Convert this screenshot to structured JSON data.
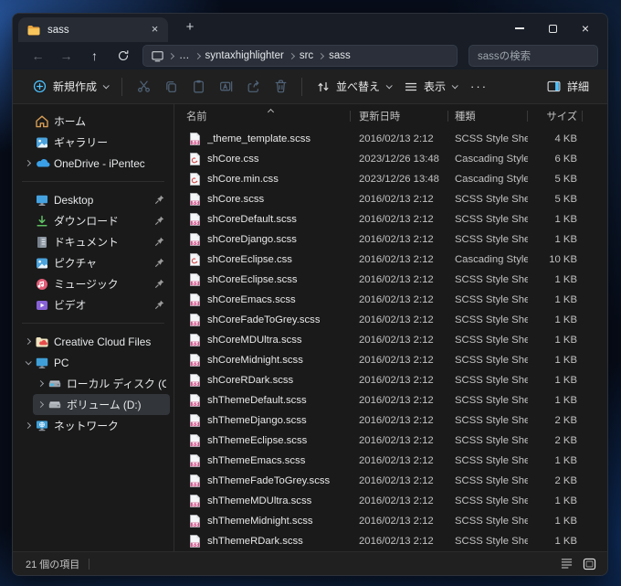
{
  "window": {
    "tab_title": "sass",
    "tab_icon": "folder-icon",
    "new_tab_label": "+",
    "controls": [
      "minimize-icon",
      "maximize-icon",
      "close-icon"
    ]
  },
  "address": {
    "device_icon": "this-pc-icon",
    "breadcrumbs": [
      "…",
      "syntaxhighlighter",
      "src",
      "sass"
    ],
    "search_text": "sassの検索"
  },
  "toolbar": {
    "new_label": "新規作成",
    "sort_label": "並べ替え",
    "view_label": "表示",
    "more_label": "···",
    "details_label": "詳細",
    "accent_color": "#4cc2ff",
    "disabled_icon_color": "#51647a"
  },
  "sidebar": {
    "items": [
      {
        "key": "home",
        "label": "ホーム",
        "icon": "home-icon",
        "chevron": "none",
        "pinned": false,
        "selected": false,
        "indent": 0
      },
      {
        "key": "gallery",
        "label": "ギャラリー",
        "icon": "gallery-icon",
        "chevron": "none",
        "pinned": false,
        "selected": false,
        "indent": 0
      },
      {
        "key": "onedrive",
        "label": "OneDrive - iPentec",
        "icon": "onedrive-icon",
        "chevron": "collapsed",
        "pinned": false,
        "selected": false,
        "indent": 0
      },
      {
        "divider": true
      },
      {
        "key": "desktop",
        "label": "Desktop",
        "icon": "desktop-icon",
        "chevron": "none",
        "pinned": true,
        "selected": false,
        "indent": 0
      },
      {
        "key": "downloads",
        "label": "ダウンロード",
        "icon": "downloads-icon",
        "chevron": "none",
        "pinned": true,
        "selected": false,
        "indent": 0
      },
      {
        "key": "documents",
        "label": "ドキュメント",
        "icon": "documents-icon",
        "chevron": "none",
        "pinned": true,
        "selected": false,
        "indent": 0
      },
      {
        "key": "pictures",
        "label": "ピクチャ",
        "icon": "pictures-icon",
        "chevron": "none",
        "pinned": true,
        "selected": false,
        "indent": 0
      },
      {
        "key": "music",
        "label": "ミュージック",
        "icon": "music-icon",
        "chevron": "none",
        "pinned": true,
        "selected": false,
        "indent": 0
      },
      {
        "key": "videos",
        "label": "ビデオ",
        "icon": "videos-icon",
        "chevron": "none",
        "pinned": true,
        "selected": false,
        "indent": 0
      },
      {
        "divider": true
      },
      {
        "key": "creative-cloud",
        "label": "Creative Cloud Files",
        "icon": "creative-cloud-icon",
        "chevron": "collapsed",
        "pinned": false,
        "selected": false,
        "indent": 0
      },
      {
        "key": "pc",
        "label": "PC",
        "icon": "pc-icon",
        "chevron": "expanded",
        "pinned": false,
        "selected": false,
        "indent": 0
      },
      {
        "key": "local-disk-c",
        "label": "ローカル ディスク (C:)",
        "icon": "system-drive-icon",
        "chevron": "collapsed",
        "pinned": false,
        "selected": false,
        "indent": 1
      },
      {
        "key": "volume-d",
        "label": "ボリューム (D:)",
        "icon": "drive-icon",
        "chevron": "collapsed",
        "pinned": false,
        "selected": true,
        "indent": 1
      },
      {
        "key": "network",
        "label": "ネットワーク",
        "icon": "network-icon",
        "chevron": "collapsed",
        "pinned": false,
        "selected": false,
        "indent": 0
      }
    ]
  },
  "files": {
    "columns": [
      "名前",
      "更新日時",
      "種類",
      "サイズ"
    ],
    "sorted_column": "名前",
    "sort_direction": "ascending",
    "rows": [
      {
        "name": "_theme_template.scss",
        "modified": "2016/02/13 2:12",
        "type": "SCSS Style Sheet",
        "size": "4 KB",
        "icon": "scss-file-icon"
      },
      {
        "name": "shCore.css",
        "modified": "2023/12/26 13:48",
        "type": "Cascading Style S...",
        "size": "6 KB",
        "icon": "css-file-icon"
      },
      {
        "name": "shCore.min.css",
        "modified": "2023/12/26 13:48",
        "type": "Cascading Style S...",
        "size": "5 KB",
        "icon": "css-file-icon"
      },
      {
        "name": "shCore.scss",
        "modified": "2016/02/13 2:12",
        "type": "SCSS Style Sheet",
        "size": "5 KB",
        "icon": "scss-file-icon"
      },
      {
        "name": "shCoreDefault.scss",
        "modified": "2016/02/13 2:12",
        "type": "SCSS Style Sheet",
        "size": "1 KB",
        "icon": "scss-file-icon"
      },
      {
        "name": "shCoreDjango.scss",
        "modified": "2016/02/13 2:12",
        "type": "SCSS Style Sheet",
        "size": "1 KB",
        "icon": "scss-file-icon"
      },
      {
        "name": "shCoreEclipse.css",
        "modified": "2016/02/13 2:12",
        "type": "Cascading Style S...",
        "size": "10 KB",
        "icon": "css-file-icon"
      },
      {
        "name": "shCoreEclipse.scss",
        "modified": "2016/02/13 2:12",
        "type": "SCSS Style Sheet",
        "size": "1 KB",
        "icon": "scss-file-icon"
      },
      {
        "name": "shCoreEmacs.scss",
        "modified": "2016/02/13 2:12",
        "type": "SCSS Style Sheet",
        "size": "1 KB",
        "icon": "scss-file-icon"
      },
      {
        "name": "shCoreFadeToGrey.scss",
        "modified": "2016/02/13 2:12",
        "type": "SCSS Style Sheet",
        "size": "1 KB",
        "icon": "scss-file-icon"
      },
      {
        "name": "shCoreMDUltra.scss",
        "modified": "2016/02/13 2:12",
        "type": "SCSS Style Sheet",
        "size": "1 KB",
        "icon": "scss-file-icon"
      },
      {
        "name": "shCoreMidnight.scss",
        "modified": "2016/02/13 2:12",
        "type": "SCSS Style Sheet",
        "size": "1 KB",
        "icon": "scss-file-icon"
      },
      {
        "name": "shCoreRDark.scss",
        "modified": "2016/02/13 2:12",
        "type": "SCSS Style Sheet",
        "size": "1 KB",
        "icon": "scss-file-icon"
      },
      {
        "name": "shThemeDefault.scss",
        "modified": "2016/02/13 2:12",
        "type": "SCSS Style Sheet",
        "size": "1 KB",
        "icon": "scss-file-icon"
      },
      {
        "name": "shThemeDjango.scss",
        "modified": "2016/02/13 2:12",
        "type": "SCSS Style Sheet",
        "size": "2 KB",
        "icon": "scss-file-icon"
      },
      {
        "name": "shThemeEclipse.scss",
        "modified": "2016/02/13 2:12",
        "type": "SCSS Style Sheet",
        "size": "2 KB",
        "icon": "scss-file-icon"
      },
      {
        "name": "shThemeEmacs.scss",
        "modified": "2016/02/13 2:12",
        "type": "SCSS Style Sheet",
        "size": "1 KB",
        "icon": "scss-file-icon"
      },
      {
        "name": "shThemeFadeToGrey.scss",
        "modified": "2016/02/13 2:12",
        "type": "SCSS Style Sheet",
        "size": "2 KB",
        "icon": "scss-file-icon"
      },
      {
        "name": "shThemeMDUltra.scss",
        "modified": "2016/02/13 2:12",
        "type": "SCSS Style Sheet",
        "size": "1 KB",
        "icon": "scss-file-icon"
      },
      {
        "name": "shThemeMidnight.scss",
        "modified": "2016/02/13 2:12",
        "type": "SCSS Style Sheet",
        "size": "1 KB",
        "icon": "scss-file-icon"
      },
      {
        "name": "shThemeRDark.scss",
        "modified": "2016/02/13 2:12",
        "type": "SCSS Style Sheet",
        "size": "1 KB",
        "icon": "scss-file-icon"
      }
    ]
  },
  "statusbar": {
    "count_label": "21 個の項目"
  }
}
